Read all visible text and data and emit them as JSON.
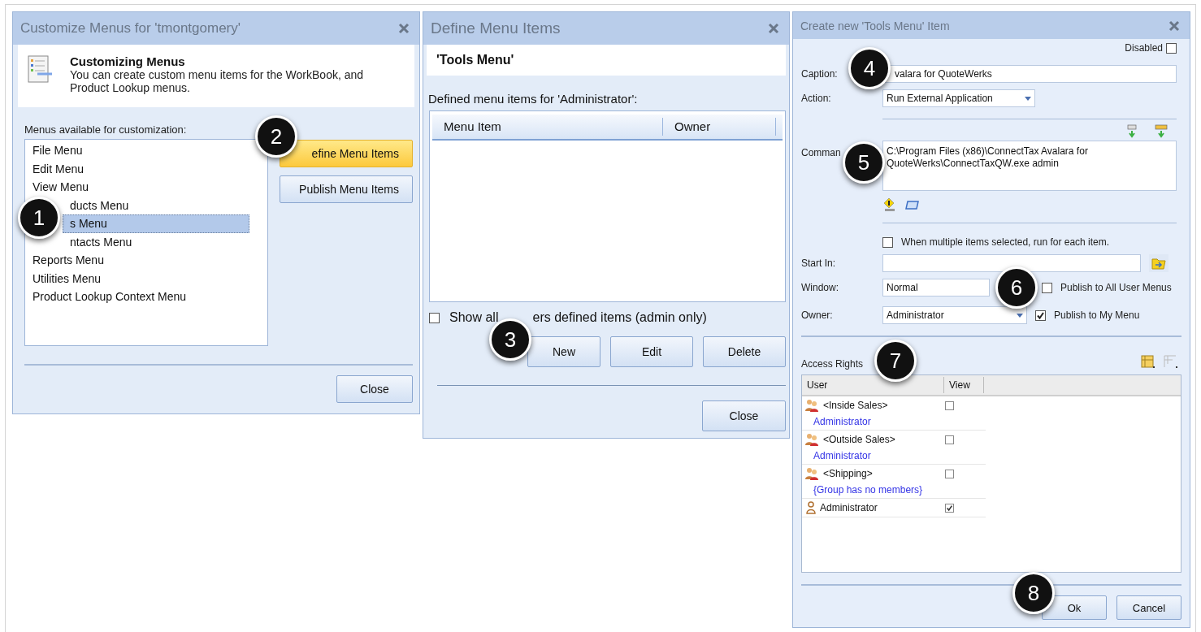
{
  "customize_dialog": {
    "title": "Customize Menus for 'tmontgomery'",
    "heading": "Customizing Menus",
    "description": "You can create custom menu items for the WorkBook, and Product Lookup menus.",
    "list_label": "Menus available for customization:",
    "menus": [
      {
        "label": "File Menu",
        "selected": false
      },
      {
        "label": "Edit Menu",
        "selected": false
      },
      {
        "label": "View Menu",
        "selected": false
      },
      {
        "label": "ducts Menu",
        "selected": false,
        "covered": true
      },
      {
        "label": "s Menu",
        "selected": true,
        "covered": true
      },
      {
        "label": "ntacts Menu",
        "selected": false,
        "covered": true
      },
      {
        "label": "Reports Menu",
        "selected": false
      },
      {
        "label": "Utilities Menu",
        "selected": false
      },
      {
        "label": "Product Lookup Context Menu",
        "selected": false
      }
    ],
    "buttons": [
      {
        "label": "efine Menu Items",
        "highlighted": true
      },
      {
        "label": "Publish Menu Items",
        "highlighted": false
      }
    ],
    "close_button": "Close"
  },
  "define_dialog": {
    "title": "Define Menu Items",
    "menu_name": "'Tools Menu'",
    "list_label": "Defined menu items for 'Administrator':",
    "columns": [
      "Menu Item",
      "Owner"
    ],
    "show_all": {
      "label_start": "Show all",
      "label_end": "ers defined items (admin only)",
      "checked": false
    },
    "buttons": [
      "New",
      "Edit",
      "Delete"
    ],
    "close_button": "Close"
  },
  "create_dialog": {
    "title": "Create new 'Tools Menu' Item",
    "disabled": {
      "label": "Disabled",
      "checked": false
    },
    "caption": {
      "label": "Caption:",
      "value": "valara for QuoteWerks"
    },
    "action": {
      "label": "Action:",
      "value": "Run External Application"
    },
    "command": {
      "label": "Comman",
      "value": "C:\\Program Files (x86)\\ConnectTax Avalara for QuoteWerks\\ConnectTaxQW.exe admin"
    },
    "run_each": {
      "label": "When multiple items selected, run for each item.",
      "checked": false
    },
    "start_in": {
      "label": "Start In:"
    },
    "window": {
      "label": "Window:",
      "value": "Normal"
    },
    "owner": {
      "label": "Owner:",
      "value": "Administrator"
    },
    "publish_all": {
      "label": "Publish to All User Menus",
      "checked": false
    },
    "publish_mine": {
      "label": "Publish to My Menu",
      "checked": true
    },
    "access_label": "Access Rights",
    "columns": [
      "User",
      "View"
    ],
    "rights": [
      {
        "kind": "group",
        "name": "<Inside Sales>",
        "members": "Administrator",
        "view": false
      },
      {
        "kind": "group",
        "name": "<Outside Sales>",
        "members": "Administrator",
        "view": false
      },
      {
        "kind": "group",
        "name": "<Shipping>",
        "members": "{Group has no members}",
        "view": false
      },
      {
        "kind": "user",
        "name": "Administrator",
        "view": true
      }
    ],
    "ok_button": "Ok",
    "cancel_button": "Cancel"
  },
  "callouts": [
    "1",
    "2",
    "3",
    "4",
    "5",
    "6",
    "7",
    "8"
  ]
}
